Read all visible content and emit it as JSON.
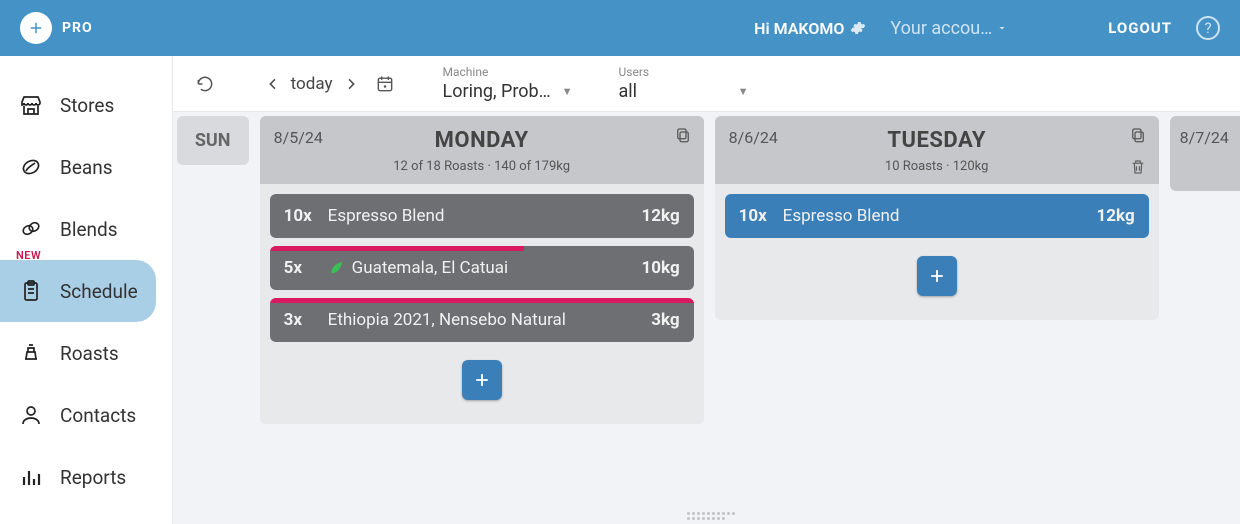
{
  "header": {
    "brand": "PRO",
    "greeting": "Hi MAKOMO",
    "account_label": "Your accou…",
    "logout_label": "LOGOUT",
    "help_char": "?"
  },
  "sidebar": {
    "items": [
      {
        "label": "Stores"
      },
      {
        "label": "Beans"
      },
      {
        "label": "Blends"
      },
      {
        "label": "Schedule",
        "badge": "NEW"
      },
      {
        "label": "Roasts"
      },
      {
        "label": "Contacts"
      },
      {
        "label": "Reports"
      }
    ]
  },
  "toolbar": {
    "today_label": "today",
    "machine": {
      "label": "Machine",
      "value": "Loring, Prob…"
    },
    "users": {
      "label": "Users",
      "value": "all"
    }
  },
  "days": {
    "sun": {
      "title": "SUN"
    },
    "mon": {
      "date": "8/5/24",
      "title": "MONDAY",
      "subtitle": "12 of 18 Roasts · 140 of 179kg",
      "roasts": [
        {
          "qty": "10x",
          "name": "Espresso Blend",
          "weight": "12kg",
          "leaf": false,
          "progress": 0
        },
        {
          "qty": "5x",
          "name": "Guatemala, El Catuai",
          "weight": "10kg",
          "leaf": true,
          "progress": 60
        },
        {
          "qty": "3x",
          "name": "Ethiopia 2021, Nensebo Natural",
          "weight": "3kg",
          "leaf": false,
          "progress": 100
        }
      ]
    },
    "tue": {
      "date": "8/6/24",
      "title": "TUESDAY",
      "subtitle": "10 Roasts · 120kg",
      "roasts": [
        {
          "qty": "10x",
          "name": "Espresso Blend",
          "weight": "12kg",
          "leaf": false,
          "blue": true
        }
      ]
    },
    "wed": {
      "date": "8/7/24"
    }
  }
}
